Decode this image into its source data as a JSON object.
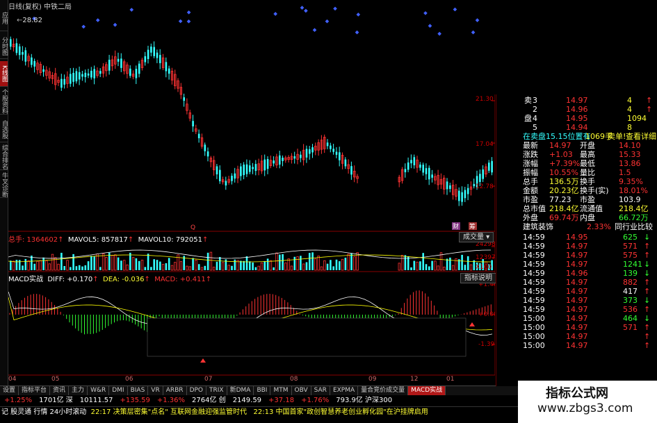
{
  "header": {
    "chart_title": "日线(复权) 中铁二局",
    "max_price": "28.82"
  },
  "left_tabs": [
    "应用",
    "分时图",
    "K线图",
    "个股资料",
    "自选股",
    "综合排名",
    "牛叉诊断"
  ],
  "price_axis": [
    "21.30",
    "17.04",
    "12.78"
  ],
  "markers": {
    "q": "Q",
    "m": "财",
    "z": "筹",
    "e": "融"
  },
  "volume": {
    "label": "总手: 1364602",
    "mavol5": "MAVOL5: 857817",
    "mavol10": "MAVOL10: 792051",
    "button": "成交量",
    "axis": [
      "24298",
      "12397",
      "X100"
    ]
  },
  "macd": {
    "label": "MACD实战",
    "diff": "DIFF: +0.170",
    "dea": "DEA: -0.036",
    "macd": "MACD: +0.411",
    "button": "指标说明",
    "axis": [
      "+1.40",
      "+0.003",
      "-1.39"
    ]
  },
  "dates": [
    "04",
    "05",
    "06",
    "07",
    "08",
    "09",
    "12",
    "01"
  ],
  "bottom_tabs": [
    "设置",
    "指标平台",
    "资讯",
    "主力",
    "W&R",
    "DMI",
    "BIAS",
    "VR",
    "ARBR",
    "DPO",
    "TRIX",
    "新DMA",
    "BBI",
    "MTM",
    "OBV",
    "SAR",
    "EXPMA",
    "量合竞价成交量",
    "MACD实战"
  ],
  "index_bar": [
    {
      "text": "+1.25%",
      "color": "red"
    },
    {
      "text": "1701亿 深",
      "color": "wht"
    },
    {
      "text": "10111.57",
      "color": "wht"
    },
    {
      "text": "+135.59",
      "color": "red"
    },
    {
      "text": "+1.36%",
      "color": "red"
    },
    {
      "text": "2764亿 创",
      "color": "wht"
    },
    {
      "text": "2149.59",
      "color": "wht"
    },
    {
      "text": "+37.18",
      "color": "red"
    },
    {
      "text": "+1.76%",
      "color": "red"
    },
    {
      "text": "793.9亿 沪深300",
      "color": "wht"
    }
  ],
  "news_bar": {
    "left": "记 股灵通 行情 24小时滚动",
    "item1": "22:17 决策层密集\"点名\" 互联网金融迎强监管时代",
    "item2": "22:13 中国首家\"政创智慧养老创业孵化园\"在沪挂牌启用"
  },
  "order_book": [
    {
      "label": "卖",
      "level": "3",
      "price": "14.97",
      "vol": "4",
      "arrow": "up"
    },
    {
      "label": "",
      "level": "2",
      "price": "14.96",
      "vol": "4",
      "arrow": "up"
    },
    {
      "label": "盘",
      "level": "4",
      "price": "14.95",
      "vol": "1094",
      "arrow": ""
    },
    {
      "label": "",
      "level": "5",
      "price": "14.94",
      "vol": "8",
      "arrow": ""
    }
  ],
  "order_note": {
    "a": "在卖盘15.15位置有",
    "b": "1069手",
    "c": "卖单!",
    "d": "查看详细"
  },
  "quote": [
    {
      "l": "最新",
      "v": "14.97",
      "vc": "red",
      "r": "开盘",
      "rv": "14.10",
      "rc": "red"
    },
    {
      "l": "涨跌",
      "v": "+1.03",
      "vc": "red",
      "r": "最高",
      "rv": "15.33",
      "rc": "red"
    },
    {
      "l": "涨幅",
      "v": "+7.39%",
      "vc": "red",
      "r": "最低",
      "rv": "13.86",
      "rc": "red"
    },
    {
      "l": "振幅",
      "v": "10.55%",
      "vc": "red",
      "r": "量比",
      "rv": "1.5",
      "rc": "red"
    },
    {
      "l": "总手",
      "v": "136.5万",
      "vc": "ylw",
      "r": "换手",
      "rv": "9.35%",
      "rc": "red"
    },
    {
      "l": "金额",
      "v": "20.23亿",
      "vc": "ylw",
      "r": "换手(实)",
      "rv": "18.01%",
      "rc": "red"
    },
    {
      "l": "市盈",
      "v": "77.23",
      "vc": "wht",
      "r": "市盈",
      "rv": "103.9",
      "rc": "wht"
    },
    {
      "l": "总市值",
      "v": "218.4亿",
      "vc": "ylw",
      "r": "流通值",
      "rv": "218.4亿",
      "rc": "ylw"
    },
    {
      "l": "外盘",
      "v": "69.74万",
      "vc": "red",
      "r": "内盘",
      "rv": "66.72万",
      "rc": "grn"
    }
  ],
  "sector": {
    "name": "建筑装饰",
    "pct": "2.33%",
    "compare": "同行业比较"
  },
  "ticks": [
    {
      "t": "14:59",
      "p": "14.95",
      "v": "625",
      "c": "grn",
      "a": "down"
    },
    {
      "t": "14:59",
      "p": "14.97",
      "v": "571",
      "c": "red",
      "a": "up"
    },
    {
      "t": "14:59",
      "p": "14.97",
      "v": "575",
      "c": "red",
      "a": "up"
    },
    {
      "t": "14:59",
      "p": "14.97",
      "v": "1241",
      "c": "grn",
      "a": "down"
    },
    {
      "t": "14:59",
      "p": "14.96",
      "v": "139",
      "c": "grn",
      "a": "down"
    },
    {
      "t": "14:59",
      "p": "14.97",
      "v": "882",
      "c": "red",
      "a": "up"
    },
    {
      "t": "14:59",
      "p": "14.97",
      "v": "417",
      "c": "wht",
      "a": "up"
    },
    {
      "t": "14:59",
      "p": "14.97",
      "v": "373",
      "c": "grn",
      "a": "down"
    },
    {
      "t": "14:59",
      "p": "14.97",
      "v": "536",
      "c": "red",
      "a": "up"
    },
    {
      "t": "15:00",
      "p": "14.97",
      "v": "464",
      "c": "grn",
      "a": "down"
    },
    {
      "t": "15:00",
      "p": "14.97",
      "v": "571",
      "c": "red",
      "a": "up"
    },
    {
      "t": "15:00",
      "p": "14.97",
      "v": "",
      "c": "red",
      "a": "up"
    },
    {
      "t": "15:00",
      "p": "14.97",
      "v": "",
      "c": "red",
      "a": "up"
    }
  ],
  "watermark": {
    "title": "指标公式网",
    "url": "www.zbgs3.com"
  },
  "colors": {
    "up": "#ff3333",
    "down": "#33ffff",
    "accent": "#b01818"
  }
}
